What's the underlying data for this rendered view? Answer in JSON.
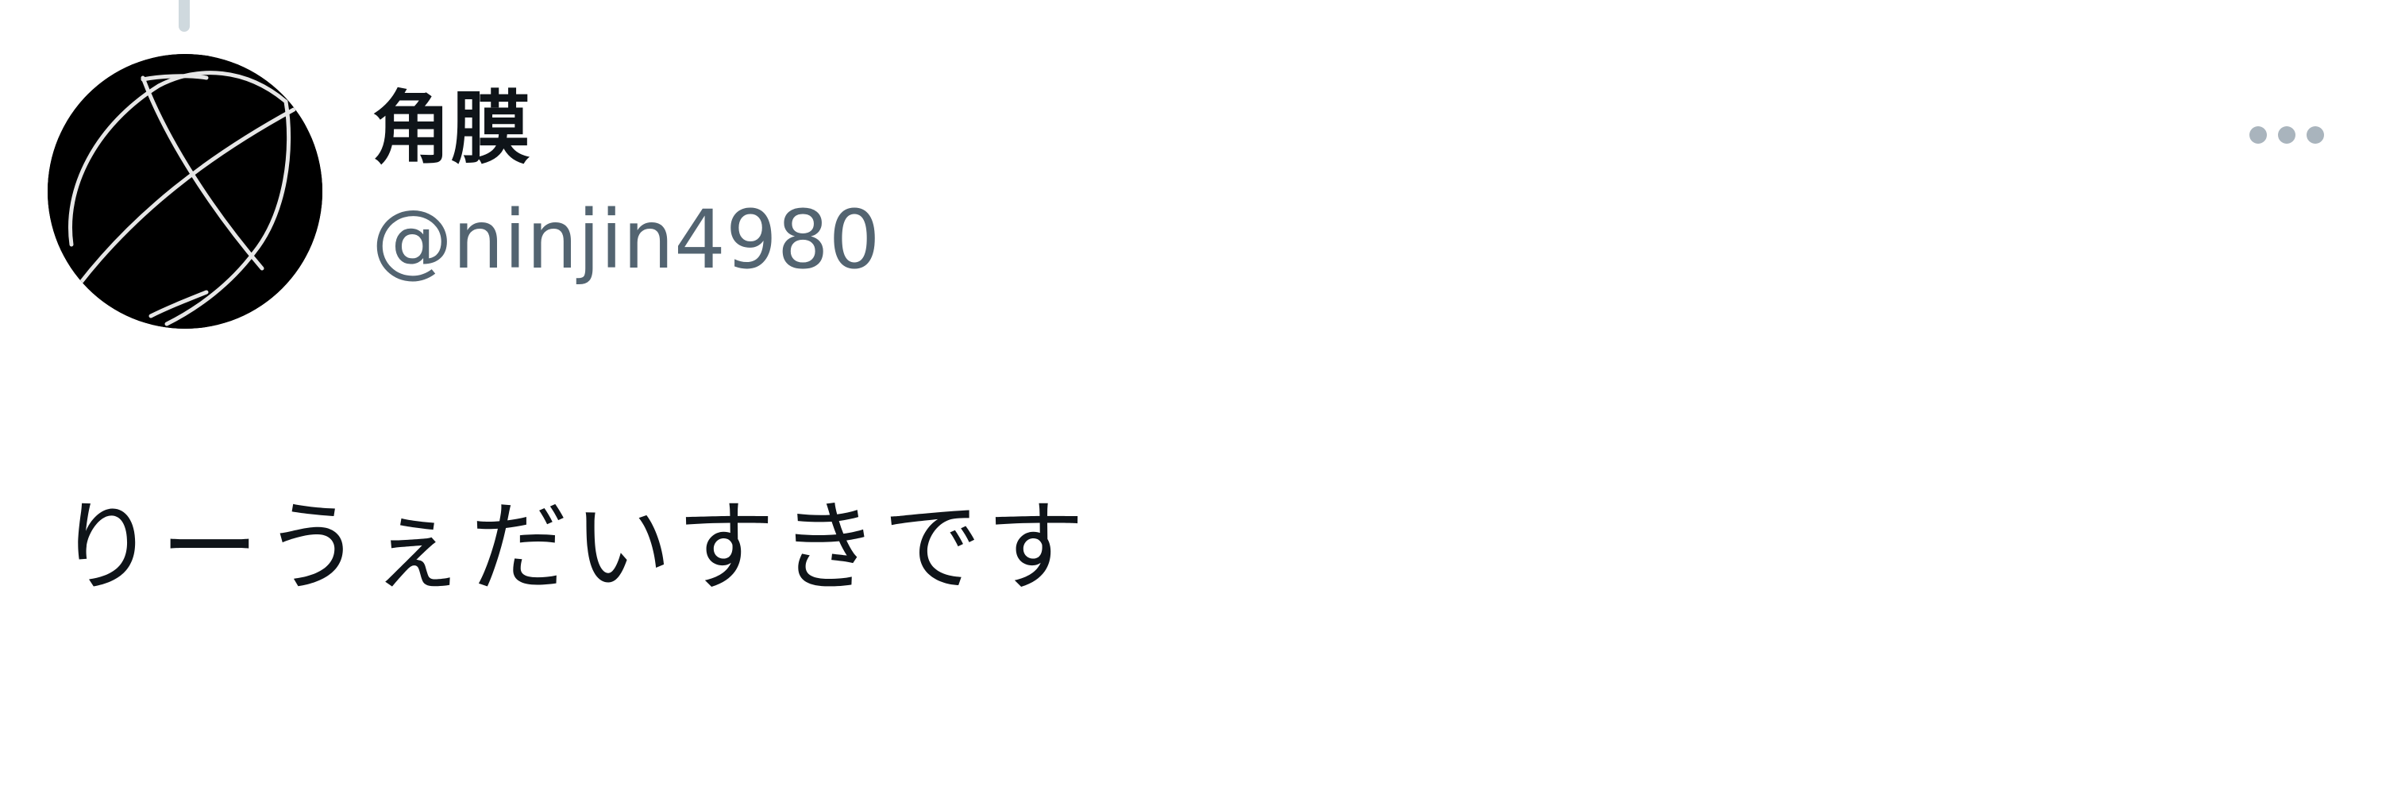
{
  "tweet": {
    "author": {
      "display_name": "角膜",
      "handle": "@ninjin4980",
      "avatar_icon": "scribbled-ball-avatar"
    },
    "text": "りーうぇだいすきです",
    "more_icon": "more-options-icon"
  },
  "colors": {
    "text_primary": "#0f1419",
    "text_secondary": "#536471",
    "icon_muted": "#a9b4bd",
    "thread_line": "#cfd9de",
    "avatar_bg": "#000000"
  }
}
